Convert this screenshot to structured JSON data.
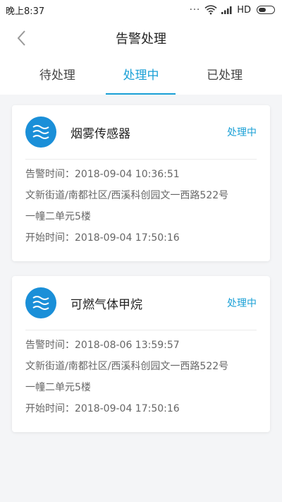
{
  "status_bar": {
    "time": "晚上8:37",
    "network": "HD"
  },
  "nav": {
    "title": "告警处理"
  },
  "tabs": [
    {
      "label": "待处理"
    },
    {
      "label": "处理中"
    },
    {
      "label": "已处理"
    }
  ],
  "alerts": [
    {
      "name": "烟雾传感器",
      "status": "处理中",
      "alarm_time": "告警时间：2018-09-04 10:36:51",
      "address_line1": "文新街道/南都社区/西溪科创园文一西路522号",
      "address_line2": "一幢二单元5楼",
      "start_time": "开始时间：2018-09-04 17:50:16"
    },
    {
      "name": "可燃气体甲烷",
      "status": "处理中",
      "alarm_time": "告警时间：2018-08-06 13:59:57",
      "address_line1": "文新街道/南都社区/西溪科创园文一西路522号",
      "address_line2": "一幢二单元5楼",
      "start_time": "开始时间：2018-09-04 17:50:16"
    }
  ],
  "colors": {
    "accent": "#1aa0d6",
    "icon_bg": "#1a8fd8"
  }
}
